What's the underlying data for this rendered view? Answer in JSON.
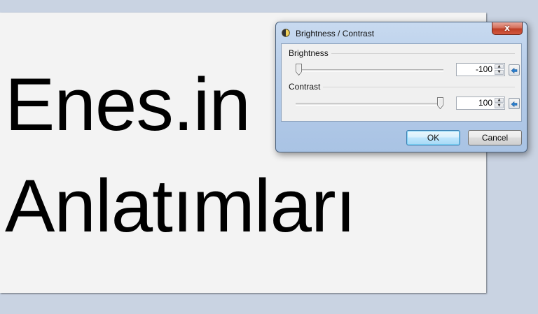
{
  "canvas": {
    "line1": "Enes.in",
    "line2": "Anlatımları"
  },
  "dialog": {
    "title": "Brightness / Contrast",
    "title_icon": "brightness-contrast-icon",
    "close_label": "x",
    "brightness": {
      "label": "Brightness",
      "value": "-100",
      "min": -100,
      "max": 100,
      "reset_icon": "reset-arrow-icon"
    },
    "contrast": {
      "label": "Contrast",
      "value": "100",
      "min": -100,
      "max": 100,
      "reset_icon": "reset-arrow-icon"
    },
    "ok_label": "OK",
    "cancel_label": "Cancel"
  }
}
